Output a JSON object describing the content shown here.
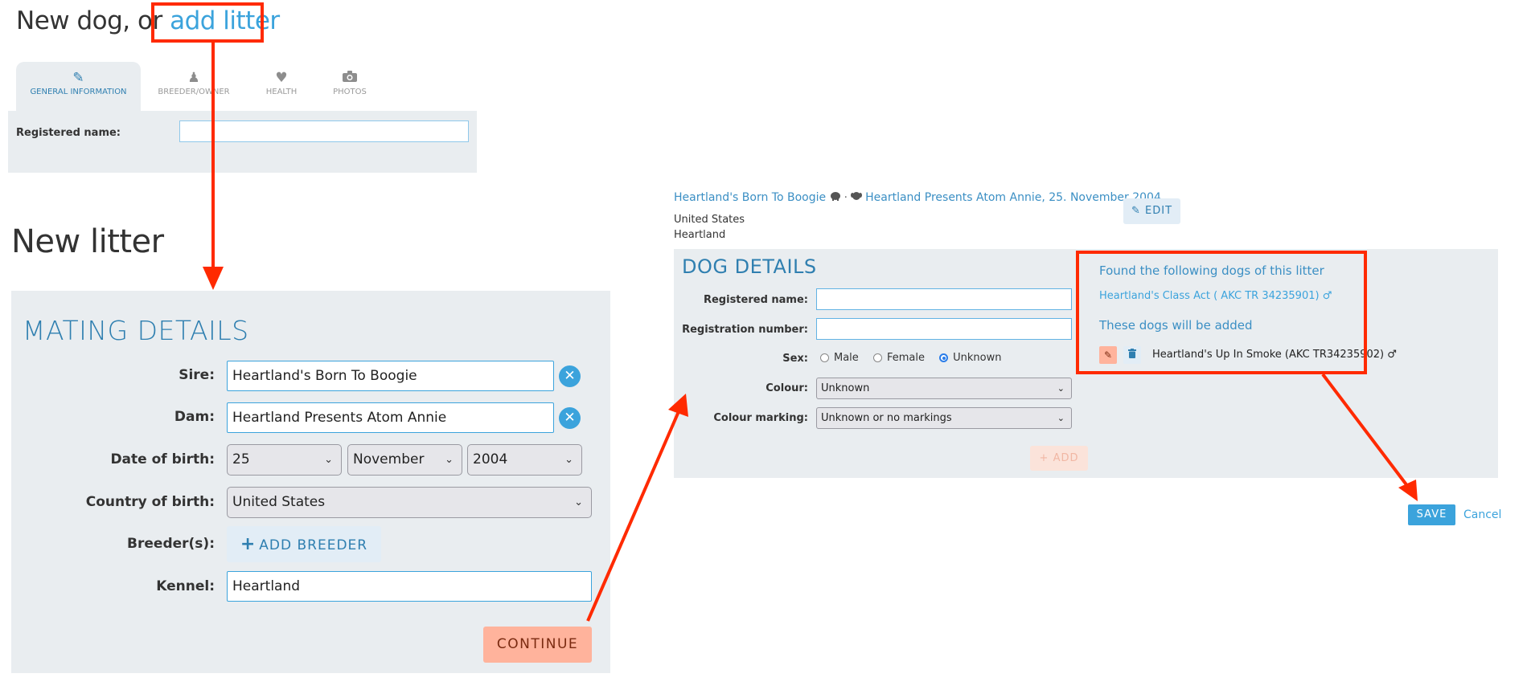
{
  "new_dog": {
    "title_prefix": "New dog, or ",
    "add_litter_link": "add litter",
    "tabs": [
      {
        "label": "GENERAL INFORMATION",
        "icon": "pencil-icon",
        "active": true
      },
      {
        "label": "BREEDER/OWNER",
        "icon": "person-icon",
        "active": false
      },
      {
        "label": "HEALTH",
        "icon": "heart-pulse-icon",
        "active": false
      },
      {
        "label": "PHOTOS",
        "icon": "camera-icon",
        "active": false
      }
    ],
    "registered_name_label": "Registered name:",
    "registered_name_value": ""
  },
  "new_litter": {
    "heading": "New litter",
    "section_title": "MATING DETAILS",
    "sire_label": "Sire:",
    "sire_value": "Heartland's Born To Boogie",
    "dam_label": "Dam:",
    "dam_value": "Heartland Presents Atom Annie",
    "dob_label": "Date of birth:",
    "dob_day": "25",
    "dob_month": "November",
    "dob_year": "2004",
    "country_label": "Country of birth:",
    "country_value": "United States",
    "breeders_label": "Breeder(s):",
    "add_breeder_label": "ADD BREEDER",
    "kennel_label": "Kennel:",
    "kennel_value": "Heartland",
    "continue_label": "CONTINUE",
    "clear_glyph": "✕",
    "plus_glyph": "+"
  },
  "litter_header": {
    "sire": "Heartland's Born To Boogie",
    "separator": "·",
    "dam": "Heartland Presents Atom Annie, 25. November 2004",
    "country": "United States",
    "kennel": "Heartland",
    "edit_label": "EDIT"
  },
  "dog_details": {
    "section_title": "DOG DETAILS",
    "registered_name_label": "Registered name:",
    "registered_name_value": "",
    "registration_number_label": "Registration number:",
    "registration_number_value": "",
    "sex_label": "Sex:",
    "sex_options": [
      "Male",
      "Female",
      "Unknown"
    ],
    "sex_selected": "Unknown",
    "colour_label": "Colour:",
    "colour_value": "Unknown",
    "colour_marking_label": "Colour marking:",
    "colour_marking_value": "Unknown or no markings",
    "add_label": "ADD"
  },
  "litter_summary": {
    "found_title": "Found the following dogs of this litter",
    "found_dogs": [
      "Heartland's Class Act ( AKC TR 34235901) ♂"
    ],
    "added_title": "These dogs will be added",
    "added_dogs": [
      "Heartland's Up In Smoke (AKC TR34235902) ♂"
    ]
  },
  "actions": {
    "save_label": "SAVE",
    "cancel_label": "Cancel"
  },
  "colors": {
    "accent_blue": "#3ba3dc",
    "heading_blue": "#2f7fb0",
    "continue_salmon": "#ffb39c",
    "panel_gray": "#e9edf0",
    "annotation_red": "#ff2a00"
  }
}
